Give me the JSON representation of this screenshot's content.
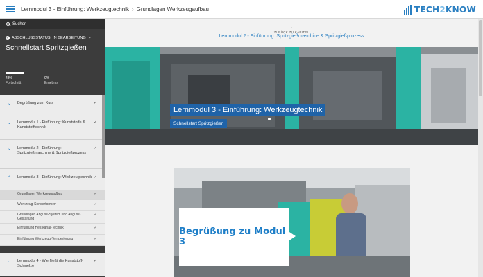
{
  "header": {
    "breadcrumbs": [
      "Lernmodul 3 - Einführung: Werkzeugtechnik",
      "Grundlagen Werkzeugaufbau"
    ],
    "separator": "›",
    "logo_left": "TECH",
    "logo_mid": "2",
    "logo_right": "KNOW"
  },
  "sidebar": {
    "search_label": "Suchen",
    "status_label": "ABSCHLUSSSTATUS: IN BEARBEITUNG",
    "course_title": "Schnellstart Spritzgießen",
    "progress": {
      "value": "48%",
      "label": "Fortschritt",
      "fraction": 0.48
    },
    "result": {
      "value": "0%",
      "label": "Ergebnis"
    },
    "items": [
      {
        "label": "Begrüßung zum Kurs"
      },
      {
        "label": "Lernmodul 1 - Einführung: Kunststoffe & Kunststofftechnik"
      },
      {
        "label": "Lernmodul 2 - Einführung: Spritzgießmaschine & Spritzgießprozess"
      },
      {
        "label": "Lernmodul 3 - Einführung: Werkzeugtechnik"
      },
      {
        "label": "Lernmodul 4 - Wie fließt die Kunststoff-Schmelze"
      }
    ],
    "subitems": [
      {
        "label": "Grundlagen Werkzeugaufbau"
      },
      {
        "label": "Werkzeug-Sonderformen"
      },
      {
        "label": "Grundlagen Anguss-System und Anguss-Gestaltung"
      },
      {
        "label": "Einführung Heißkanal-Technik"
      },
      {
        "label": "Einführung Werkzeug-Temperierung"
      }
    ]
  },
  "main": {
    "back_label": "ZURÜCK ZU KAPITEL",
    "chapter_link": "Lernmodul 2 - Einführung: Spritzgießmaschine & Spritzgießprozess",
    "hero_title": "Lernmodul 3 - Einführung: Werkzeugtechnik",
    "hero_subtitle": "Schnellstart Spritzgießen",
    "video_card": "Begrüßung zu Modul 3"
  },
  "colors": {
    "accent": "#2a7fc1",
    "sidebar_bg": "#3c3c3c",
    "hero_label_bg": "#1f63a8",
    "machine_teal": "#2bb3a3"
  }
}
